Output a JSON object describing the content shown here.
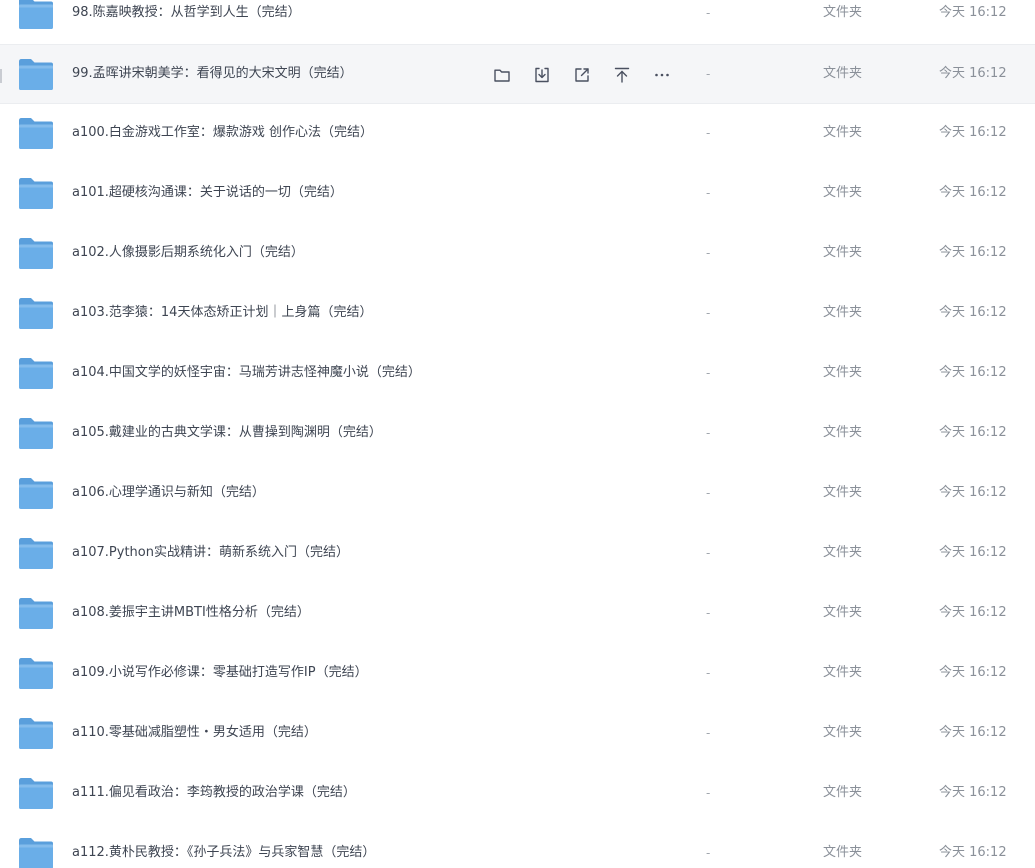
{
  "file_list": {
    "rows": [
      {
        "name": "98.陈嘉映教授：从哲学到人生（完结）",
        "size": "-",
        "type": "文件夹",
        "modified": "今天 16:12"
      },
      {
        "name": "99.孟晖讲宋朝美学：看得见的大宋文明（完结）",
        "size": "-",
        "type": "文件夹",
        "modified": "今天 16:12",
        "hovered": true
      },
      {
        "name": "a100.白金游戏工作室：爆款游戏 创作心法（完结）",
        "size": "-",
        "type": "文件夹",
        "modified": "今天 16:12"
      },
      {
        "name": "a101.超硬核沟通课：关于说话的一切（完结）",
        "size": "-",
        "type": "文件夹",
        "modified": "今天 16:12"
      },
      {
        "name": "a102.人像摄影后期系统化入门（完结）",
        "size": "-",
        "type": "文件夹",
        "modified": "今天 16:12"
      },
      {
        "name": "a103.范李猿：14天体态矫正计划｜上身篇（完结）",
        "size": "-",
        "type": "文件夹",
        "modified": "今天 16:12"
      },
      {
        "name": "a104.中国文学的妖怪宇宙：马瑞芳讲志怪神魔小说（完结）",
        "size": "-",
        "type": "文件夹",
        "modified": "今天 16:12"
      },
      {
        "name": "a105.戴建业的古典文学课：从曹操到陶渊明（完结）",
        "size": "-",
        "type": "文件夹",
        "modified": "今天 16:12"
      },
      {
        "name": "a106.心理学通识与新知（完结）",
        "size": "-",
        "type": "文件夹",
        "modified": "今天 16:12"
      },
      {
        "name": "a107.Python实战精讲：萌新系统入门（完结）",
        "size": "-",
        "type": "文件夹",
        "modified": "今天 16:12"
      },
      {
        "name": "a108.姜振宇主讲MBTI性格分析（完结）",
        "size": "-",
        "type": "文件夹",
        "modified": "今天 16:12"
      },
      {
        "name": "a109.小说写作必修课：零基础打造写作IP（完结）",
        "size": "-",
        "type": "文件夹",
        "modified": "今天 16:12"
      },
      {
        "name": "a110.零基础减脂塑性・男女适用（完结）",
        "size": "-",
        "type": "文件夹",
        "modified": "今天 16:12"
      },
      {
        "name": "a111.偏见看政治：李筠教授的政治学课（完结）",
        "size": "-",
        "type": "文件夹",
        "modified": "今天 16:12"
      },
      {
        "name": "a112.黄朴民教授：《孙子兵法》与兵家智慧（完结）",
        "size": "-",
        "type": "文件夹",
        "modified": "今天 16:12"
      }
    ],
    "row_actions": [
      {
        "name": "open-folder",
        "icon": "folder-outline-icon"
      },
      {
        "name": "download",
        "icon": "download-icon"
      },
      {
        "name": "share",
        "icon": "share-icon"
      },
      {
        "name": "move-to-top",
        "icon": "pin-to-top-icon"
      },
      {
        "name": "more",
        "icon": "more-icon"
      }
    ]
  },
  "colors": {
    "folder_body": "#6aaee8",
    "folder_tab": "#5a9fdc",
    "hover_background": "#f5f6f8",
    "text_primary": "#3e4552",
    "text_secondary": "#8a9099"
  }
}
